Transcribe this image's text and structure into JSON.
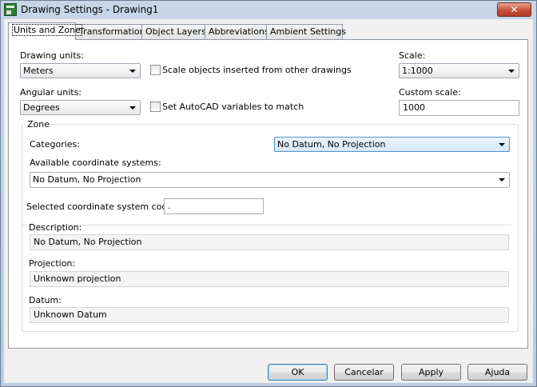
{
  "window": {
    "title": "Drawing Settings - Drawing1",
    "close_glyph": "✕",
    "icon": "drawing-settings-icon"
  },
  "tabs": [
    {
      "label": "Units and Zone",
      "active": true
    },
    {
      "label": "Transformation"
    },
    {
      "label": "Object Layers"
    },
    {
      "label": "Abbreviations"
    },
    {
      "label": "Ambient Settings"
    }
  ],
  "units": {
    "drawing_units_label": "Drawing units:",
    "drawing_units_value": "Meters",
    "scale_objects_label": "Scale objects inserted from other drawings",
    "scale_objects_checked": false,
    "angular_units_label": "Angular units:",
    "angular_units_value": "Degrees",
    "set_autocad_label": "Set AutoCAD variables to match",
    "set_autocad_checked": false,
    "scale_label": "Scale:",
    "scale_value": "1:1000",
    "custom_scale_label": "Custom scale:",
    "custom_scale_value": "1000"
  },
  "zone": {
    "legend": "Zone",
    "categories_label": "Categories:",
    "categories_value": "No Datum, No Projection",
    "available_label": "Available coordinate systems:",
    "available_value": "No Datum, No Projection",
    "selected_code_label": "Selected coordinate system code:",
    "selected_code_value": ".",
    "description_label": "Description:",
    "description_value": "No Datum, No Projection",
    "projection_label": "Projection:",
    "projection_value": "Unknown projection",
    "datum_label": "Datum:",
    "datum_value": "Unknown Datum"
  },
  "buttons": {
    "ok": "OK",
    "cancel": "Cancelar",
    "apply": "Apply",
    "help": "Ajuda"
  }
}
